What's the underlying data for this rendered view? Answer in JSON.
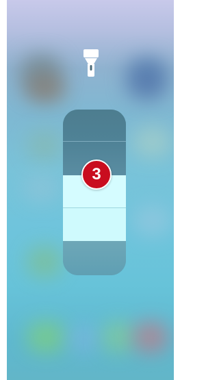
{
  "control_center": {
    "flashlight_icon": "flashlight-icon",
    "brightness_level_on": 2,
    "brightness_level_count": 5
  },
  "annotation": {
    "step_number": "3",
    "badge_color": "#c90d1f"
  },
  "colors": {
    "slider_lit": "#d5fcff",
    "slider_dim": "#4f8296"
  }
}
